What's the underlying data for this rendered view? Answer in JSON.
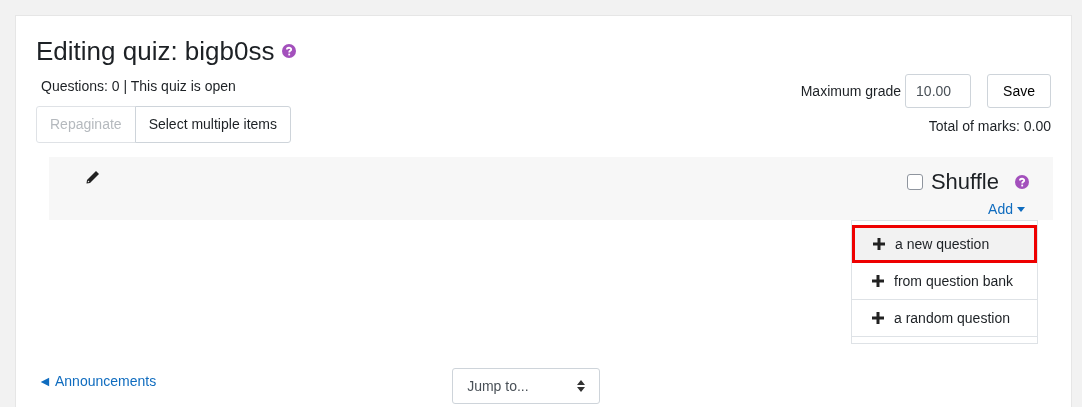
{
  "header": {
    "title": "Editing quiz: bigb0ss",
    "info": "Questions: 0 | This quiz is open"
  },
  "toolbar": [
    {
      "label": "Repaginate",
      "disabled": true
    },
    {
      "label": "Select multiple items",
      "disabled": false
    }
  ],
  "grade": {
    "label": "Maximum grade",
    "value": "10.00",
    "save": "Save",
    "total": "Total of marks: 0.00"
  },
  "section": {
    "shuffle": {
      "label": "Shuffle",
      "checked": false
    },
    "add": "Add",
    "expanded": true
  },
  "add_menu": [
    {
      "label": "a new question",
      "selected": true
    },
    {
      "label": "from question bank",
      "selected": false
    },
    {
      "label": "a random question",
      "selected": false
    }
  ],
  "footer": {
    "prev_link": "◄ Announcements",
    "jump": "Jump to..."
  }
}
